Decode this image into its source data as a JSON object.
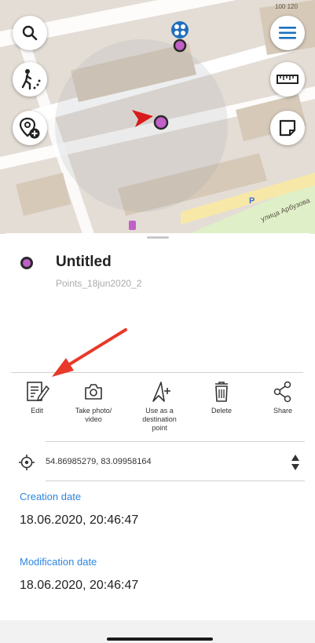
{
  "map": {
    "scale_label": "100 120",
    "street_label": "улица Арбузова",
    "parking_label": "P",
    "colors": {
      "background": "#e4ddd6",
      "road": "#ffffff",
      "building": "#d6c9b8",
      "park": "#dff0c8"
    }
  },
  "map_buttons": {
    "search_icon": "search-icon",
    "route_icon": "walking-route-icon",
    "add_place_icon": "add-location-icon",
    "menu_icon": "hamburger-menu-icon",
    "ruler_icon": "ruler-icon",
    "note_icon": "note-icon"
  },
  "point": {
    "title": "Untitled",
    "subtitle": "Points_18jun2020_2",
    "marker_color": "#c060c8"
  },
  "actions": [
    {
      "id": "edit",
      "label": "Edit",
      "icon": "edit-icon"
    },
    {
      "id": "photo",
      "label": "Take photo/ video",
      "icon": "camera-icon"
    },
    {
      "id": "destination",
      "label": "Use as a destination point",
      "icon": "navigation-arrow-plus-icon"
    },
    {
      "id": "delete",
      "label": "Delete",
      "icon": "trash-icon"
    },
    {
      "id": "share",
      "label": "Share",
      "icon": "share-icon"
    }
  ],
  "coordinates": {
    "value": "54.86985279, 83.09958164",
    "icon": "crosshair-icon",
    "stepper_icon": "sort-arrows-icon"
  },
  "creation": {
    "label": "Creation date",
    "value": "18.06.2020, 20:46:47"
  },
  "modification": {
    "label": "Modification date",
    "value": "18.06.2020, 20:46:47"
  },
  "accent_color": "#2e86de",
  "annotation": {
    "arrow_color": "#e8392a"
  }
}
